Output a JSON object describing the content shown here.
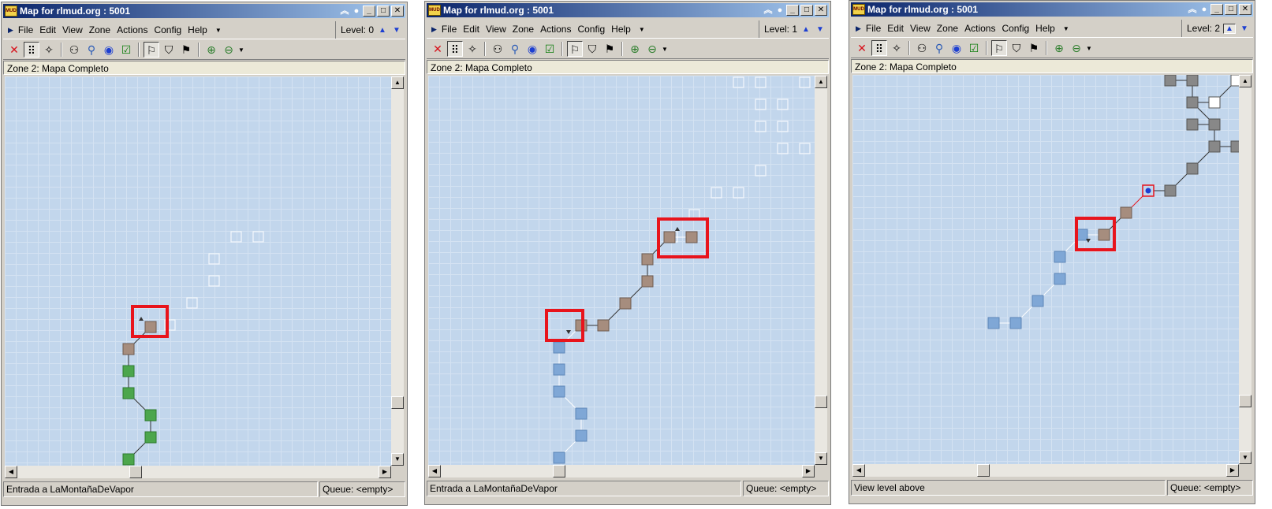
{
  "colors": {
    "title_from": "#0a246a",
    "title_to": "#a6caf0",
    "map_bg": "#c2d6ec",
    "room_brown": "#a68d7e",
    "room_green": "#4ca64c",
    "room_blue": "#7fa7d6",
    "room_gray": "#888888",
    "highlight_red": "#e8141c"
  },
  "menu": {
    "file": "File",
    "edit": "Edit",
    "view": "View",
    "zone": "Zone",
    "actions": "Actions",
    "config": "Config",
    "help": "Help"
  },
  "windows": [
    {
      "title": "Map for rlmud.org : 5001",
      "level": "Level: 0",
      "zone_label": "Zone 2: Mapa Completo",
      "status": "Entrada a LaMontañaDeVapor",
      "queue": "Queue: <empty>"
    },
    {
      "title": "Map for rlmud.org : 5001",
      "level": "Level: 1",
      "zone_label": "Zone 2: Mapa Completo",
      "status": "Entrada a LaMontañaDeVapor",
      "queue": "Queue: <empty>"
    },
    {
      "title": "Map for rlmud.org : 5001",
      "level": "Level: 2",
      "zone_label": "Zone 2: Mapa Completo",
      "status": "View level above",
      "queue": "Queue: <empty>"
    }
  ],
  "icons": {
    "app": "MUD",
    "menu_arrow": "toolbar-grip-arrow",
    "delete": "red-x-icon",
    "level_up": "triangle-up-icon",
    "level_down": "triangle-down-icon"
  }
}
